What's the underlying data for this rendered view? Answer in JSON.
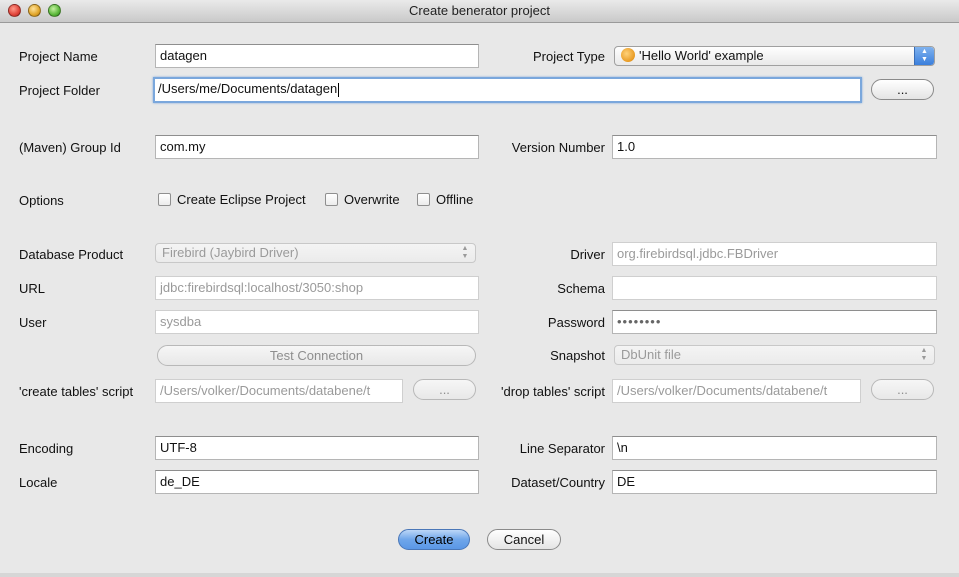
{
  "window": {
    "title": "Create benerator project"
  },
  "project_name": {
    "label": "Project Name",
    "value": "datagen"
  },
  "project_type": {
    "label": "Project Type",
    "value": "'Hello World' example"
  },
  "project_folder": {
    "label": "Project Folder",
    "value": "/Users/me/Documents/datagen",
    "browse_label": "..."
  },
  "group_id": {
    "label": "(Maven) Group Id",
    "value": "com.my"
  },
  "version_number": {
    "label": "Version Number",
    "value": "1.0"
  },
  "options": {
    "label": "Options",
    "create_eclipse": "Create Eclipse Project",
    "overwrite": "Overwrite",
    "offline": "Offline"
  },
  "database_product": {
    "label": "Database Product",
    "value": "Firebird (Jaybird Driver)"
  },
  "driver": {
    "label": "Driver",
    "value": "org.firebirdsql.jdbc.FBDriver"
  },
  "url": {
    "label": "URL",
    "value": "jdbc:firebirdsql:localhost/3050:shop"
  },
  "schema": {
    "label": "Schema",
    "value": ""
  },
  "user": {
    "label": "User",
    "value": "sysdba"
  },
  "password": {
    "label": "Password",
    "value": "••••••••"
  },
  "test_connection": {
    "label": "Test Connection"
  },
  "snapshot": {
    "label": "Snapshot",
    "value": "DbUnit file"
  },
  "create_tables": {
    "label": "'create tables' script",
    "value": "/Users/volker/Documents/databene/t",
    "browse_label": "..."
  },
  "drop_tables": {
    "label": "'drop tables' script",
    "value": "/Users/volker/Documents/databene/t",
    "browse_label": "..."
  },
  "encoding": {
    "label": "Encoding",
    "value": "UTF-8"
  },
  "line_separator": {
    "label": "Line Separator",
    "value": "\\n"
  },
  "locale": {
    "label": "Locale",
    "value": "de_DE"
  },
  "dataset_country": {
    "label": "Dataset/Country",
    "value": "DE"
  },
  "actions": {
    "create": "Create",
    "cancel": "Cancel"
  },
  "colors": {
    "accent": "#5a97e6",
    "focus_ring": "#7aa7dc"
  }
}
